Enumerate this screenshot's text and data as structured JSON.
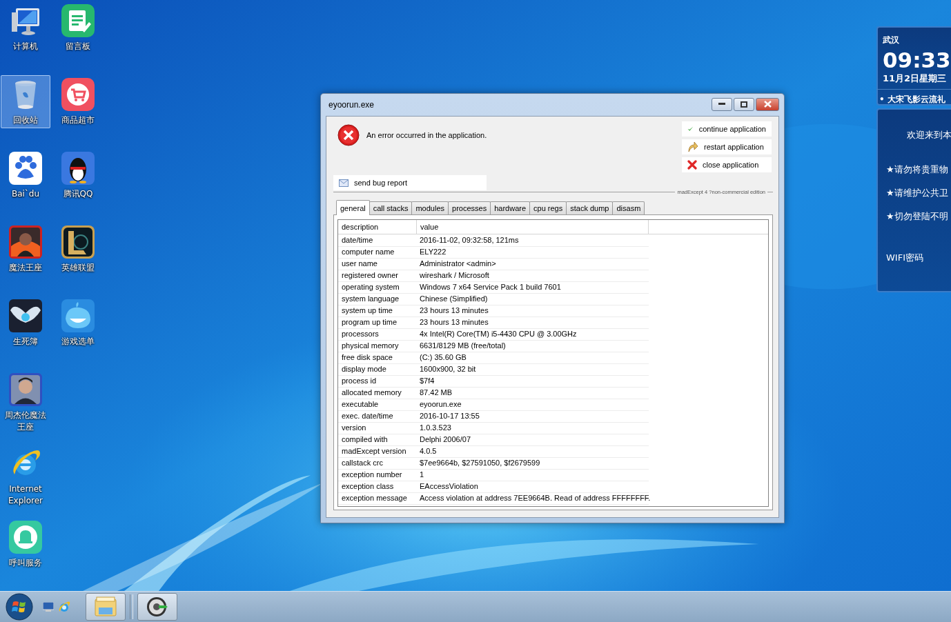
{
  "desktop_icons": [
    {
      "label": "计算机",
      "selected": false
    },
    {
      "label": "回收站",
      "selected": true
    },
    {
      "label": "Bai`du",
      "selected": false
    },
    {
      "label": "魔法王座",
      "selected": false
    },
    {
      "label": "生死簿",
      "selected": false
    },
    {
      "label": "周杰伦魔法王座",
      "selected": false
    },
    {
      "label": "Internet Explorer",
      "selected": false
    },
    {
      "label": "呼叫服务",
      "selected": false
    },
    {
      "label": "留言板",
      "selected": false
    },
    {
      "label": "商品超市",
      "selected": false
    },
    {
      "label": "腾讯QQ",
      "selected": false
    },
    {
      "label": "英雄联盟",
      "selected": false
    },
    {
      "label": "游戏选单",
      "selected": false
    }
  ],
  "error_window": {
    "title": "eyoorun.exe",
    "message": "An error occurred in the application.",
    "send_button": "send bug report",
    "actions": [
      "continue application",
      "restart application",
      "close application"
    ],
    "edition": "madExcept 4 ?non-commercial edition",
    "tabs": [
      {
        "label": "general",
        "selected": true
      },
      {
        "label": "call stacks",
        "selected": false
      },
      {
        "label": "modules",
        "selected": false
      },
      {
        "label": "processes",
        "selected": false
      },
      {
        "label": "hardware",
        "selected": false
      },
      {
        "label": "cpu regs",
        "selected": false
      },
      {
        "label": "stack dump",
        "selected": false
      },
      {
        "label": "disasm",
        "selected": false
      }
    ],
    "table": {
      "columns": [
        "description",
        "value"
      ],
      "rows": [
        [
          "date/time",
          "2016-11-02, 09:32:58, 121ms"
        ],
        [
          "computer name",
          "ELY222"
        ],
        [
          "user name",
          "Administrator  <admin>"
        ],
        [
          "registered owner",
          "wireshark / Microsoft"
        ],
        [
          "operating system",
          "Windows 7 x64 Service Pack 1 build 7601"
        ],
        [
          "system language",
          "Chinese (Simplified)"
        ],
        [
          "system up time",
          "23 hours 13 minutes"
        ],
        [
          "program up time",
          "23 hours 13 minutes"
        ],
        [
          "processors",
          "4x Intel(R) Core(TM) i5-4430 CPU @ 3.00GHz"
        ],
        [
          "physical memory",
          "6631/8129 MB (free/total)"
        ],
        [
          "free disk space",
          "(C:) 35.60 GB"
        ],
        [
          "display mode",
          "1600x900, 32 bit"
        ],
        [
          "process id",
          "$7f4"
        ],
        [
          "allocated memory",
          "87.42 MB"
        ],
        [
          "executable",
          "eyoorun.exe"
        ],
        [
          "exec. date/time",
          "2016-10-17 13:55"
        ],
        [
          "version",
          "1.0.3.523"
        ],
        [
          "compiled with",
          "Delphi 2006/07"
        ],
        [
          "madExcept version",
          "4.0.5"
        ],
        [
          "callstack crc",
          "$7ee9664b, $27591050, $f2679599"
        ],
        [
          "exception number",
          "1"
        ],
        [
          "exception class",
          "EAccessViolation"
        ],
        [
          "exception message",
          "Access violation at address 7EE9664B. Read of address FFFFFFFF."
        ]
      ]
    }
  },
  "widget": {
    "city": "武汉",
    "time": "09:33",
    "date": "11月2日星期三",
    "ticker": "• 大宋飞影云流礼",
    "notices": [
      "欢迎来到本",
      "★请勿将贵重物",
      "★请维护公共卫",
      "★切勿登陆不明",
      "WIFI密码"
    ]
  }
}
